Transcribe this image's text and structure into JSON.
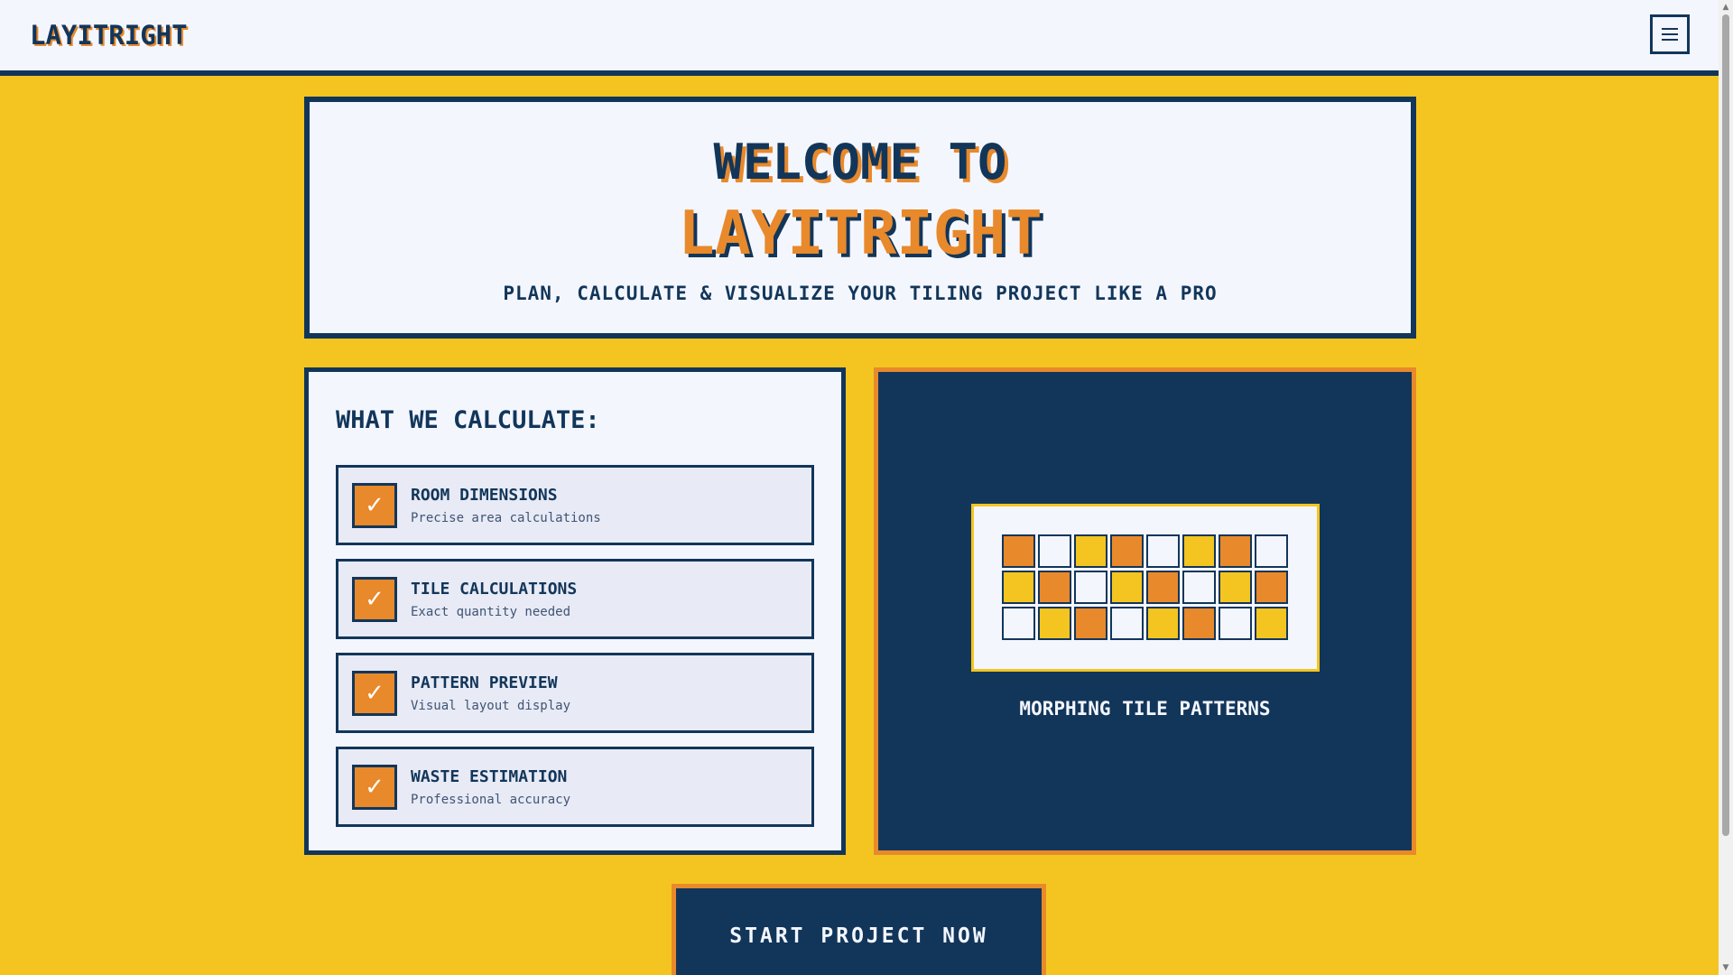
{
  "header": {
    "logo": "LAYITRIGHT",
    "menu_icon": "hamburger-menu-icon"
  },
  "hero": {
    "line1": "WELCOME TO",
    "line2": "LAYITRIGHT",
    "subtitle": "PLAN, CALCULATE & VISUALIZE YOUR TILING PROJECT LIKE A PRO"
  },
  "calculate": {
    "title": "WHAT WE CALCULATE:",
    "check_icon": "checkmark-icon",
    "check_glyph": "✓",
    "items": [
      {
        "title": "ROOM DIMENSIONS",
        "desc": "Precise area calculations"
      },
      {
        "title": "TILE CALCULATIONS",
        "desc": "Exact quantity needed"
      },
      {
        "title": "PATTERN PREVIEW",
        "desc": "Visual layout display"
      },
      {
        "title": "WASTE ESTIMATION",
        "desc": "Professional accuracy"
      }
    ]
  },
  "pattern": {
    "label": "MORPHING TILE PATTERNS",
    "tile_colors": {
      "o": "#E8892B",
      "y": "#F4C520",
      "w": "#F4F6FE"
    },
    "rows": [
      [
        "o",
        "w",
        "y",
        "o",
        "w",
        "y",
        "o",
        "w"
      ],
      [
        "y",
        "o",
        "w",
        "y",
        "o",
        "w",
        "y",
        "o"
      ],
      [
        "w",
        "y",
        "o",
        "w",
        "y",
        "o",
        "w",
        "y"
      ]
    ]
  },
  "cta": {
    "label": "START PROJECT NOW"
  },
  "colors": {
    "navy": "#12365A",
    "orange": "#E8892B",
    "yellow": "#F4C520",
    "offwhite": "#F4F6FE"
  }
}
